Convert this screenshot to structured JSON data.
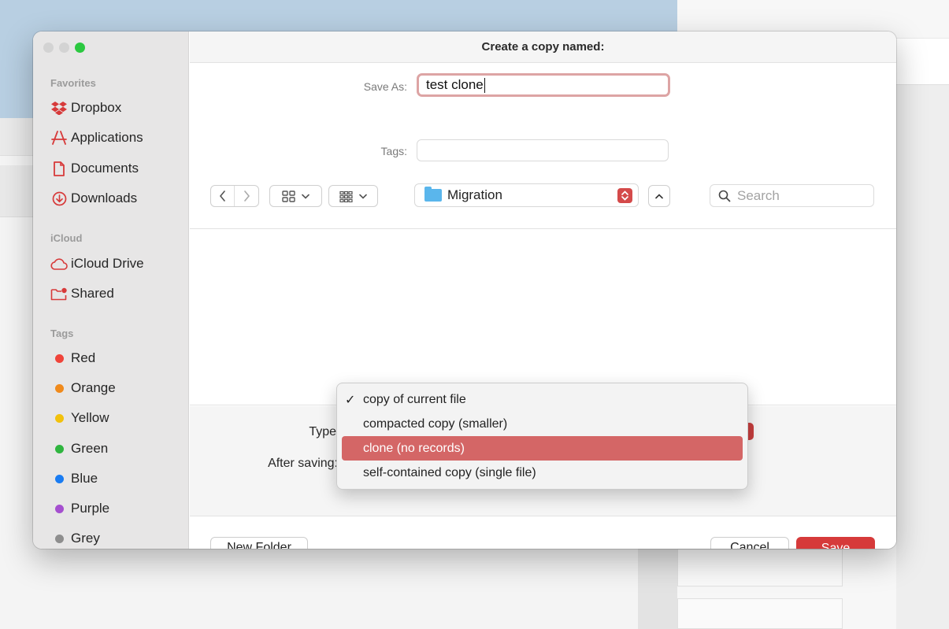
{
  "dialog": {
    "title": "Create a copy named:",
    "save_as_label": "Save As:",
    "save_as_value": "test clone",
    "tags_label": "Tags:",
    "tags_value": "",
    "location": "Migration",
    "search_placeholder": "Search"
  },
  "sidebar": {
    "favorites_heading": "Favorites",
    "favorites": [
      {
        "label": "Dropbox",
        "icon": "dropbox-icon"
      },
      {
        "label": "Applications",
        "icon": "applications-icon"
      },
      {
        "label": "Documents",
        "icon": "document-icon"
      },
      {
        "label": "Downloads",
        "icon": "download-icon"
      }
    ],
    "icloud_heading": "iCloud",
    "icloud": [
      {
        "label": "iCloud Drive",
        "icon": "cloud-icon"
      },
      {
        "label": "Shared",
        "icon": "shared-folder-icon"
      }
    ],
    "tags_heading": "Tags",
    "tags": [
      {
        "label": "Red",
        "color": "#f0443a"
      },
      {
        "label": "Orange",
        "color": "#f08a1c"
      },
      {
        "label": "Yellow",
        "color": "#f2c10c"
      },
      {
        "label": "Green",
        "color": "#2fb53f"
      },
      {
        "label": "Blue",
        "color": "#1a7cf2"
      },
      {
        "label": "Purple",
        "color": "#a54fcf"
      },
      {
        "label": "Grey",
        "color": "#8e8e8e"
      }
    ]
  },
  "options": {
    "type_label": "Type",
    "after_saving_label": "After saving:",
    "type_menu": [
      {
        "label": "copy of current file",
        "checked": true,
        "highlighted": false
      },
      {
        "label": "compacted copy (smaller)",
        "checked": false,
        "highlighted": false
      },
      {
        "label": "clone (no records)",
        "checked": false,
        "highlighted": true
      },
      {
        "label": "self-contained copy (single file)",
        "checked": false,
        "highlighted": false
      }
    ]
  },
  "footer": {
    "new_folder_label": "New Folder",
    "cancel_label": "Cancel",
    "save_label": "Save"
  },
  "colors": {
    "accent": "#d63a3a",
    "menu_highlight": "#d46666"
  }
}
